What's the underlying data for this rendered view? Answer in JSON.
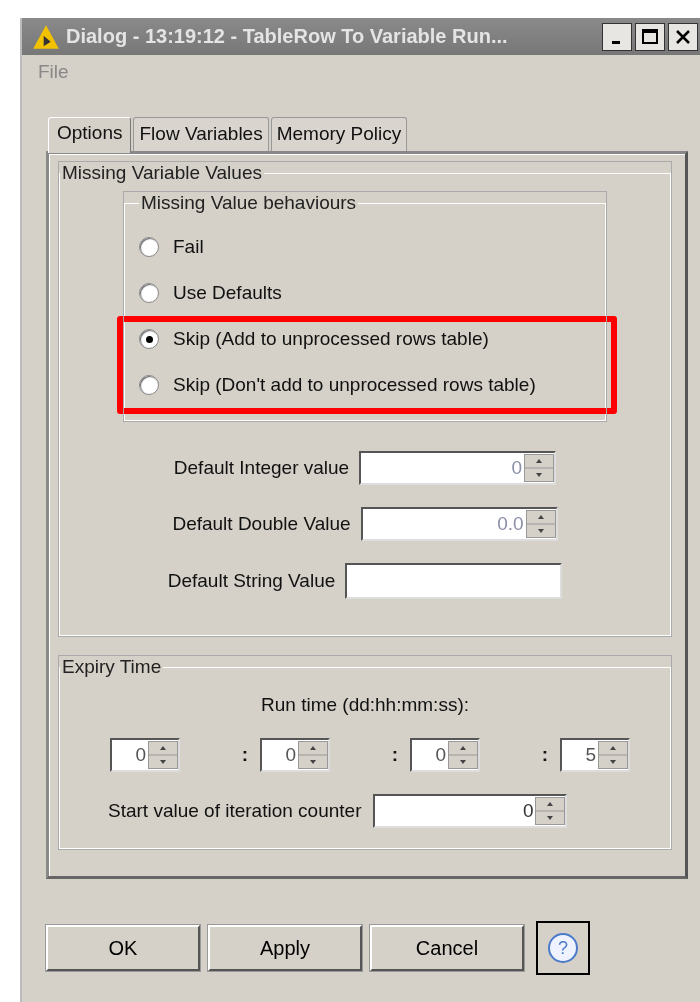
{
  "window": {
    "title": "Dialog - 13:19:12 - TableRow To Variable Run..."
  },
  "menu": [
    "File"
  ],
  "tabs": [
    {
      "label": "Options",
      "selected": true
    },
    {
      "label": "Flow Variables",
      "selected": false
    },
    {
      "label": "Memory Policy",
      "selected": false
    }
  ],
  "missing_values": {
    "title": "Missing Variable Values",
    "behaviours": {
      "title": "Missing Value behaviours",
      "options": [
        {
          "label": "Fail",
          "selected": false,
          "highlighted": false
        },
        {
          "label": "Use Defaults",
          "selected": false,
          "highlighted": false
        },
        {
          "label": "Skip (Add to unprocessed rows table)",
          "selected": true,
          "highlighted": true
        },
        {
          "label": "Skip (Don't add to unprocessed rows table)",
          "selected": false,
          "highlighted": true
        }
      ]
    },
    "fields": [
      {
        "label": "Default Integer value",
        "value": "0",
        "kind": "spinner",
        "disabled": true
      },
      {
        "label": "Default Double Value",
        "value": "0.0",
        "kind": "spinner",
        "disabled": true
      },
      {
        "label": "Default String Value",
        "kind": "text",
        "disabled": false
      }
    ]
  },
  "expiry": {
    "title": "Expiry Time",
    "run_time_label": "Run time (dd:hh:mm:ss):",
    "run_time": [
      {
        "value": "0"
      },
      {
        "separator": ":",
        "value": "0"
      },
      {
        "separator": ":",
        "value": "0"
      },
      {
        "separator": ":",
        "value": "5"
      }
    ],
    "iteration": {
      "label": "Start value of iteration counter",
      "value": "0"
    }
  },
  "buttons": [
    {
      "kind": "text",
      "label": "OK"
    },
    {
      "kind": "text",
      "label": "Apply"
    },
    {
      "kind": "text",
      "label": "Cancel"
    },
    {
      "kind": "help",
      "label": "?"
    }
  ]
}
